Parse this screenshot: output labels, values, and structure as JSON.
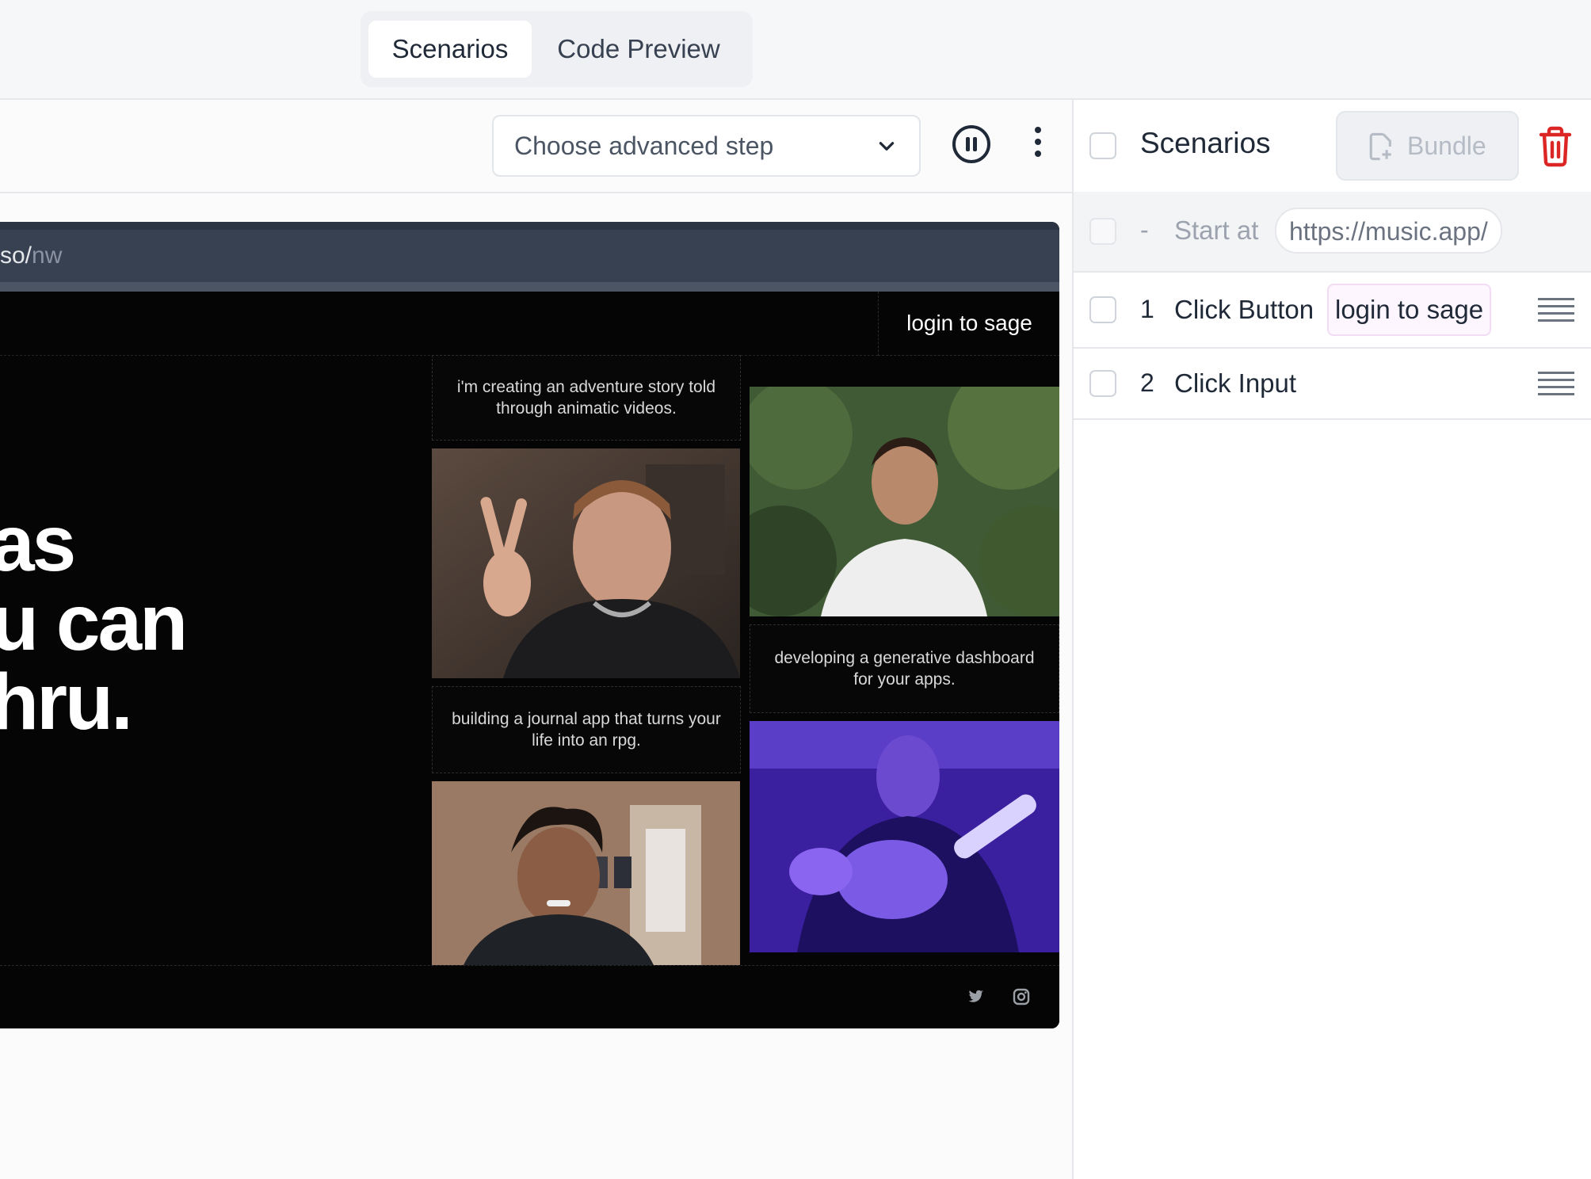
{
  "tabs": [
    {
      "label": "Scenarios",
      "active": true
    },
    {
      "label": "Code Preview",
      "active": false
    }
  ],
  "toolbar": {
    "select_placeholder": "Choose advanced step"
  },
  "browser": {
    "url_host": "so/",
    "url_path": "nw",
    "site": {
      "login_label": "login to sage",
      "hero_lines": [
        "as",
        "u can",
        "hru."
      ],
      "captions": [
        "i'm creating an adventure story told through animatic videos.",
        "building a journal app that turns your life into an rpg.",
        "developing a generative dashboard for your apps."
      ]
    }
  },
  "panel": {
    "title": "Scenarios",
    "bundle_label": "Bundle",
    "start": {
      "dash": "-",
      "label": "Start at",
      "url": "https://music.app/"
    },
    "steps": [
      {
        "num": "1",
        "label": "Click Button",
        "target": "login to sage"
      },
      {
        "num": "2",
        "label": "Click Input",
        "target": ""
      }
    ]
  },
  "colors": {
    "trash": "#dc2626",
    "chip_border": "#f1dcf3",
    "browser_bar": "#374151"
  }
}
